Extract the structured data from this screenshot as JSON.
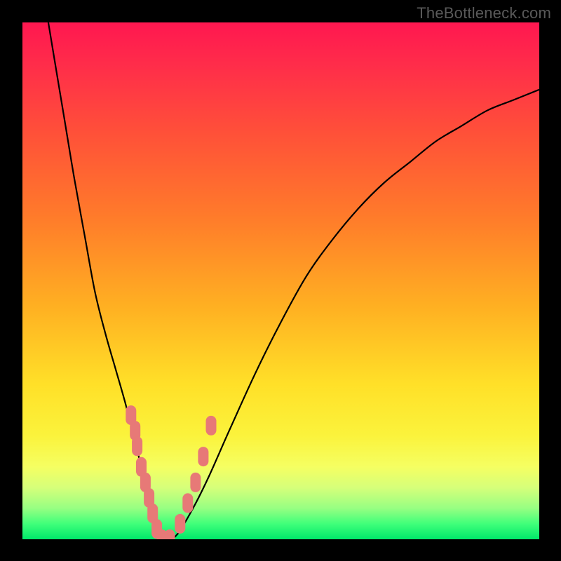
{
  "watermark": "TheBottleneck.com",
  "colors": {
    "frame": "#000000",
    "gradient_top": "#ff1750",
    "gradient_bottom": "#00e86a",
    "curve_stroke": "#000000",
    "marker_fill": "#e77977",
    "watermark_text": "#5a5a5a"
  },
  "chart_data": {
    "type": "line",
    "title": "",
    "xlabel": "",
    "ylabel": "",
    "xlim": [
      0,
      100
    ],
    "ylim": [
      0,
      100
    ],
    "grid": false,
    "series": [
      {
        "name": "bottleneck-curve",
        "x": [
          5,
          8,
          10,
          12,
          14,
          16,
          18,
          20,
          22,
          24,
          25,
          26,
          28,
          30,
          33,
          36,
          40,
          45,
          50,
          55,
          60,
          65,
          70,
          75,
          80,
          85,
          90,
          95,
          100
        ],
        "y": [
          100,
          82,
          70,
          59,
          48,
          40,
          33,
          26,
          18,
          10,
          5,
          2,
          0,
          1,
          6,
          12,
          21,
          32,
          42,
          51,
          58,
          64,
          69,
          73,
          77,
          80,
          83,
          85,
          87
        ]
      }
    ],
    "markers": [
      {
        "name": "left-cluster",
        "x": [
          21.0,
          21.8,
          22.2,
          23.0,
          23.8,
          24.5,
          25.2,
          26.0
        ],
        "y": [
          24,
          21,
          18,
          14,
          11,
          8,
          5,
          2
        ]
      },
      {
        "name": "bottom",
        "x": [
          27.0,
          28.5
        ],
        "y": [
          0,
          0
        ]
      },
      {
        "name": "right-cluster",
        "x": [
          30.5,
          32.0,
          33.5,
          35.0,
          36.5
        ],
        "y": [
          3,
          7,
          11,
          16,
          22
        ]
      }
    ]
  }
}
